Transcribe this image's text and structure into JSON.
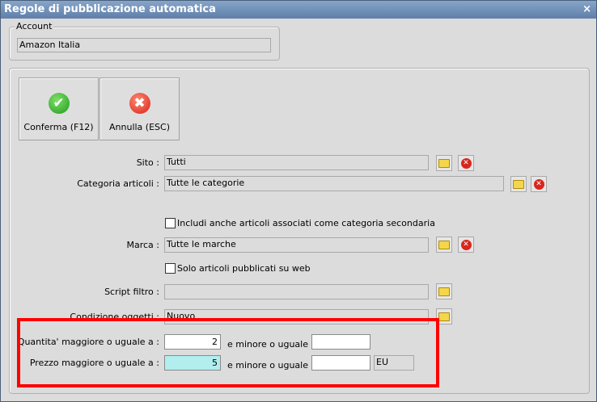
{
  "window": {
    "title": "Regole di pubblicazione automatica",
    "close": "×"
  },
  "account": {
    "legend": "Account",
    "value": "Amazon Italia"
  },
  "buttons": {
    "confirm": "Conferma (F12)",
    "cancel": "Annulla (ESC)"
  },
  "fields": {
    "sito": {
      "label": "Sito :",
      "value": "Tutti"
    },
    "categoria": {
      "label": "Categoria articoli :",
      "value": "Tutte le categorie"
    },
    "secondaria": {
      "label": "Includi anche articoli associati come categoria secondaria",
      "checked": false
    },
    "marca": {
      "label": "Marca :",
      "value": "Tutte le marche"
    },
    "web": {
      "label": "Solo articoli pubblicati su web",
      "checked": false
    },
    "script": {
      "label": "Script filtro :",
      "value": ""
    },
    "condizione": {
      "label": "Condizione oggetti :",
      "value": "Nuovo"
    },
    "quantita": {
      "label": "Quantita' maggiore o uguale a :",
      "min": "2",
      "max_label": "e minore o uguale a",
      "max": ""
    },
    "prezzo": {
      "label": "Prezzo maggiore o uguale a :",
      "min": "5",
      "max_label": "e minore o uguale a",
      "max": "",
      "currency": "EU"
    }
  },
  "colors": {
    "highlight": "#b2eeee",
    "annotation": "#ff0000"
  }
}
